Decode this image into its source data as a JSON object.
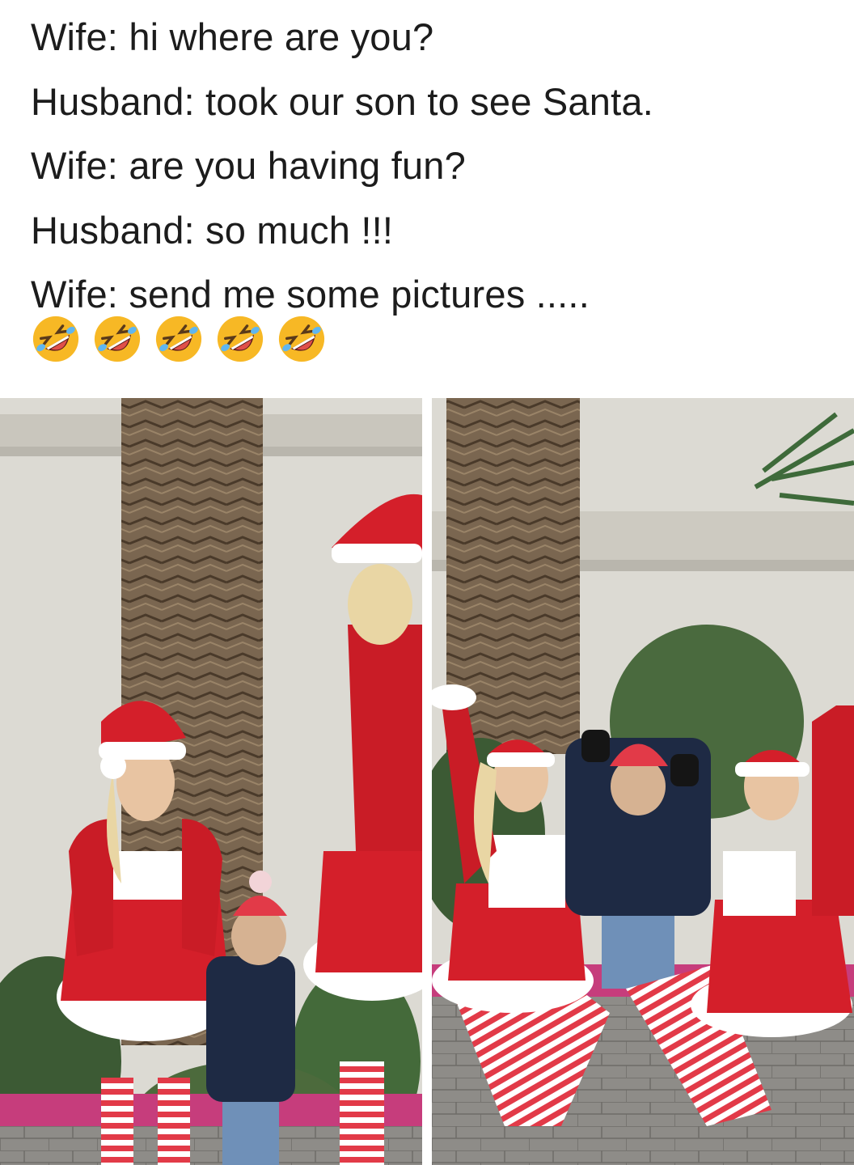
{
  "post": {
    "lines": [
      "Wife: hi where are you?",
      "Husband: took our son to see Santa.",
      "Wife: are you having fun?",
      "Husband: so much !!!",
      "Wife: send me some pictures ....."
    ],
    "emojis": [
      "rolling-on-floor-laughing-icon",
      "rolling-on-floor-laughing-icon",
      "rolling-on-floor-laughing-icon",
      "rolling-on-floor-laughing-icon",
      "rolling-on-floor-laughing-icon"
    ]
  },
  "colors": {
    "text": "#1c1c1c",
    "emoji_face": "#f7b825",
    "santa_red": "#d41f2a",
    "fur_white": "#ffffff",
    "stocking_stripe": "#e23a48",
    "jacket_navy": "#1e2a44",
    "wall": "#dcdad3",
    "palm_trunk": "#6b5a45",
    "pavement": "#8c8a86",
    "curb_pink": "#c63d7c"
  }
}
